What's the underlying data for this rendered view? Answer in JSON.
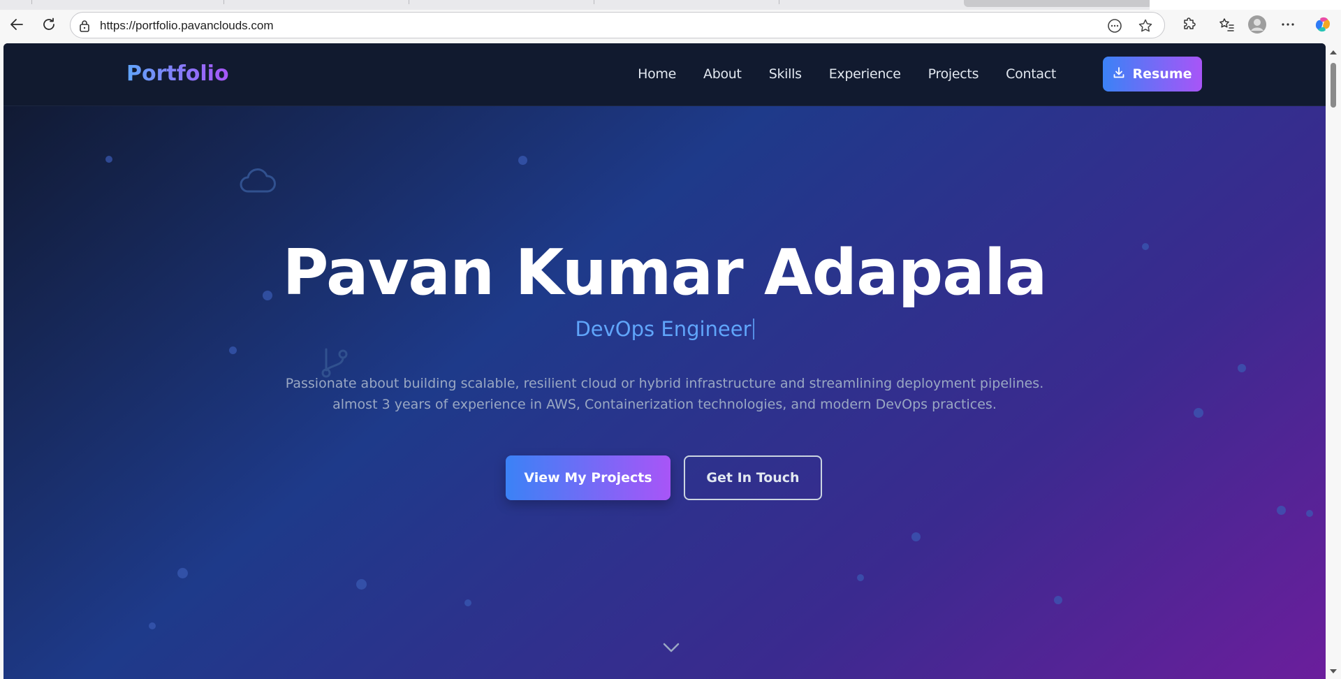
{
  "browser": {
    "url": "https://portfolio.pavanclouds.com",
    "icons": {
      "back": "back-arrow-icon",
      "reload": "reload-icon",
      "lock": "lock-icon",
      "reading_mode": "reading-mode-icon",
      "favorite": "star-icon",
      "extensions": "puzzle-icon",
      "favorites_list": "favorites-list-icon",
      "profile": "profile-icon",
      "menu": "more-icon",
      "copilot": "copilot-icon"
    }
  },
  "nav": {
    "brand": "Portfolio",
    "links": [
      "Home",
      "About",
      "Skills",
      "Experience",
      "Projects",
      "Contact"
    ],
    "resume_label": "Resume"
  },
  "hero": {
    "name": "Pavan Kumar Adapala",
    "role": "DevOps Engineer",
    "description_line1": "Passionate about building scalable, resilient cloud or hybrid infrastructure and streamlining deployment pipelines.",
    "description_line2": "almost 3 years of experience in AWS, Containerization technologies, and modern DevOps practices.",
    "primary_cta": "View My Projects",
    "secondary_cta": "Get In Touch"
  },
  "colors": {
    "accent_blue": "#3b82f6",
    "accent_purple": "#a855f7",
    "role_text": "#60a5fa",
    "nav_bg": "#111a2f"
  }
}
